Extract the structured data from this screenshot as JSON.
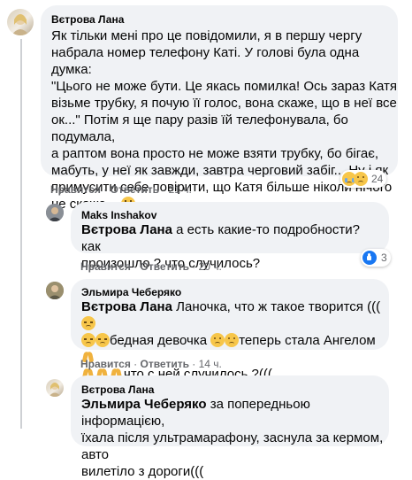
{
  "comments": [
    {
      "author": "Вєтрова Лана",
      "lines": [
        "Як тільки мені про це повідомили, я в першу чергу",
        "набрала номер телефону Каті. У голові була одна думка:",
        "\"Цього не може бути. Це якась помилка! Ось зараз Катя",
        "візьме трубку, я почую її голос, вона скаже, що в неї все",
        "ок...\" Потім я ще пару разів їй телефонувала, бо подумала,",
        "а раптом вона просто не може взяти трубку, бо бігає,",
        "мабуть, у неї як завжди, завтра черговий забіг... Ну і як",
        "примусити себе повірити, що Катя більше ніколи нічого",
        "не скаже..."
      ],
      "trailing_emoji": "screaming-face-icon",
      "like_label": "Нравится",
      "reply_label": "Ответить",
      "time": "21 ч.",
      "reaction_count": "24"
    },
    {
      "author": "Maks Inshakov",
      "mention": "Вєтрова Лана",
      "lines": [
        "а есть какие-то подробности? как",
        "произошло ? что случилось?"
      ],
      "like_label": "Нравится",
      "reply_label": "Ответить",
      "time": "20 ч.",
      "reaction_count": "3"
    },
    {
      "author": "Эльмира Чеберяко",
      "mention": "Вєтрова Лана",
      "line1": "Ланочка, что ж такое творится (((",
      "line2_a": "бедная девочка",
      "line2_b": "теперь стала Ангелом",
      "line3": "что с ней случилось ?(((",
      "like_label": "Нравится",
      "reply_label": "Ответить",
      "time": "14 ч."
    },
    {
      "author": "Вєтрова Лана",
      "mention": "Эльмира Чеберяко",
      "lines": [
        "за попередньою інформацією,",
        "їхала після ультрамарафону, заснула за кермом, авто",
        "вилетіло з дороги((("
      ]
    }
  ],
  "colors": {
    "bubble": "#f0f2f5",
    "meta_text": "#65676b",
    "like_blue": "#1877f2"
  }
}
